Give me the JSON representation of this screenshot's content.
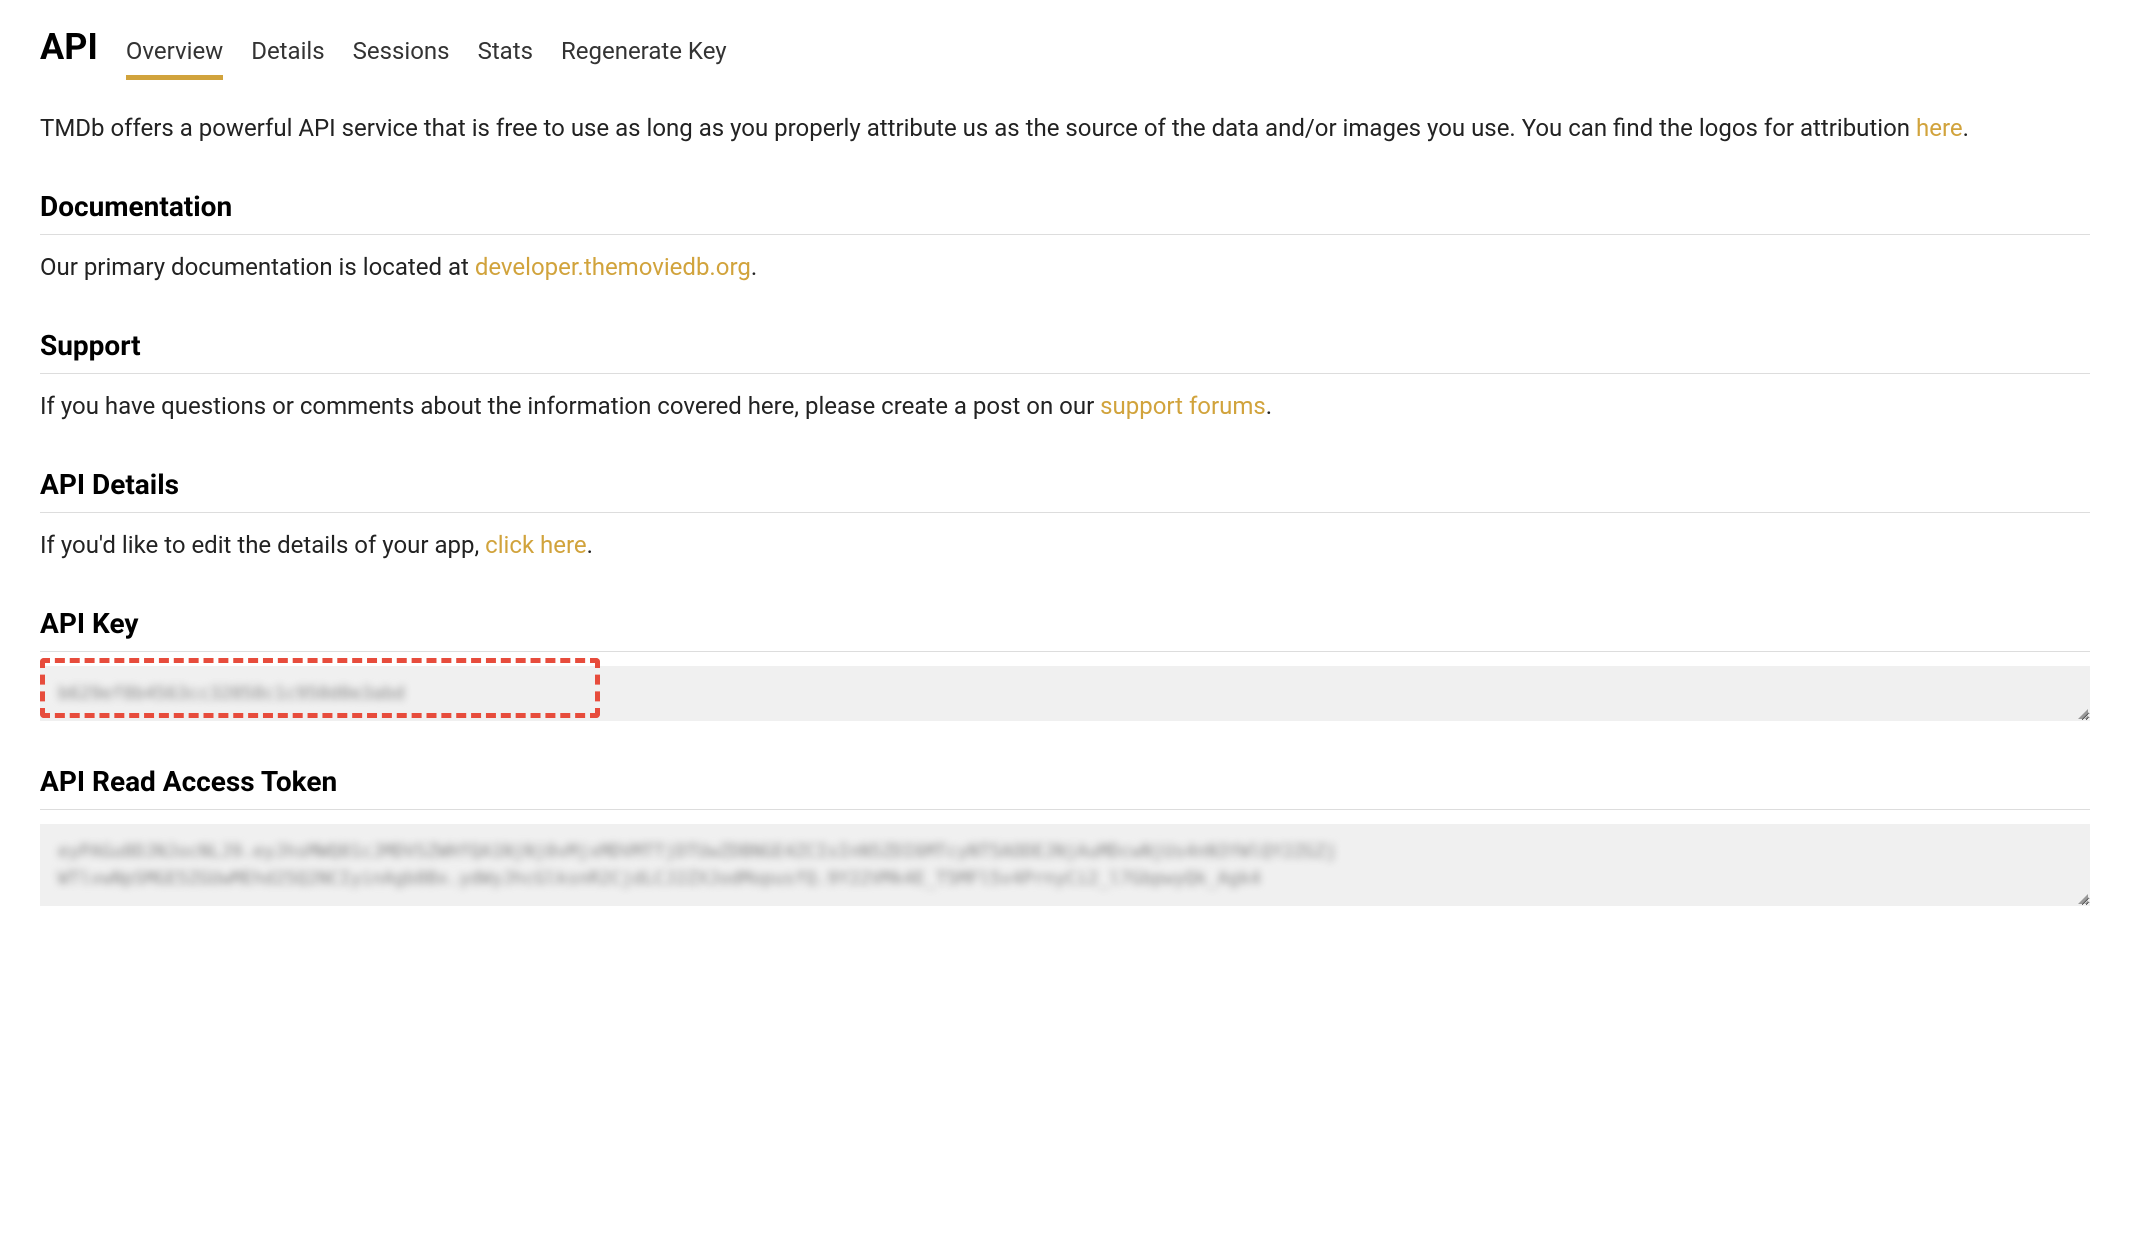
{
  "header": {
    "title": "API",
    "tabs": [
      {
        "label": "Overview",
        "active": true
      },
      {
        "label": "Details",
        "active": false
      },
      {
        "label": "Sessions",
        "active": false
      },
      {
        "label": "Stats",
        "active": false
      },
      {
        "label": "Regenerate Key",
        "active": false
      }
    ]
  },
  "intro": {
    "text_before": "TMDb offers a powerful API service that is free to use as long as you properly attribute us as the source of the data and/or images you use. You can find the logos for attribution ",
    "link": "here",
    "text_after": "."
  },
  "sections": {
    "documentation": {
      "heading": "Documentation",
      "text_before": "Our primary documentation is located at ",
      "link": "developer.themoviedb.org",
      "text_after": "."
    },
    "support": {
      "heading": "Support",
      "text_before": "If you have questions or comments about the information covered here, please create a post on our ",
      "link": "support forums",
      "text_after": "."
    },
    "api_details": {
      "heading": "API Details",
      "text_before": "If you'd like to edit the details of your app, ",
      "link": "click here",
      "text_after": "."
    },
    "api_key": {
      "heading": "API Key",
      "value": "b629ef8b4563cc32058c1c950d0e3abd"
    },
    "api_token": {
      "heading": "API Read Access Token",
      "value": "eyPAGu0DJNJocNLJ9.eyJhsMWQ01cJMDVSZWHfQA1NjNj0vMjxMDVMTTjDTUwZDBNGE4ZCIsInN5ZDI6MTcyNT5AODEJNjAuMDcwNjUs4nN3YWlQY2ZGZj WTlvwNpSMGE5ZGUwMEhd25Q2NCIyinAgb8Bx.ydWyJhcGlksnR2CjdLCJ2ZXJodMopusfQ.9Y22VMk4E_T5MFl5v4PrnyCi2_l7GbpwyQk_Agk4"
    }
  }
}
